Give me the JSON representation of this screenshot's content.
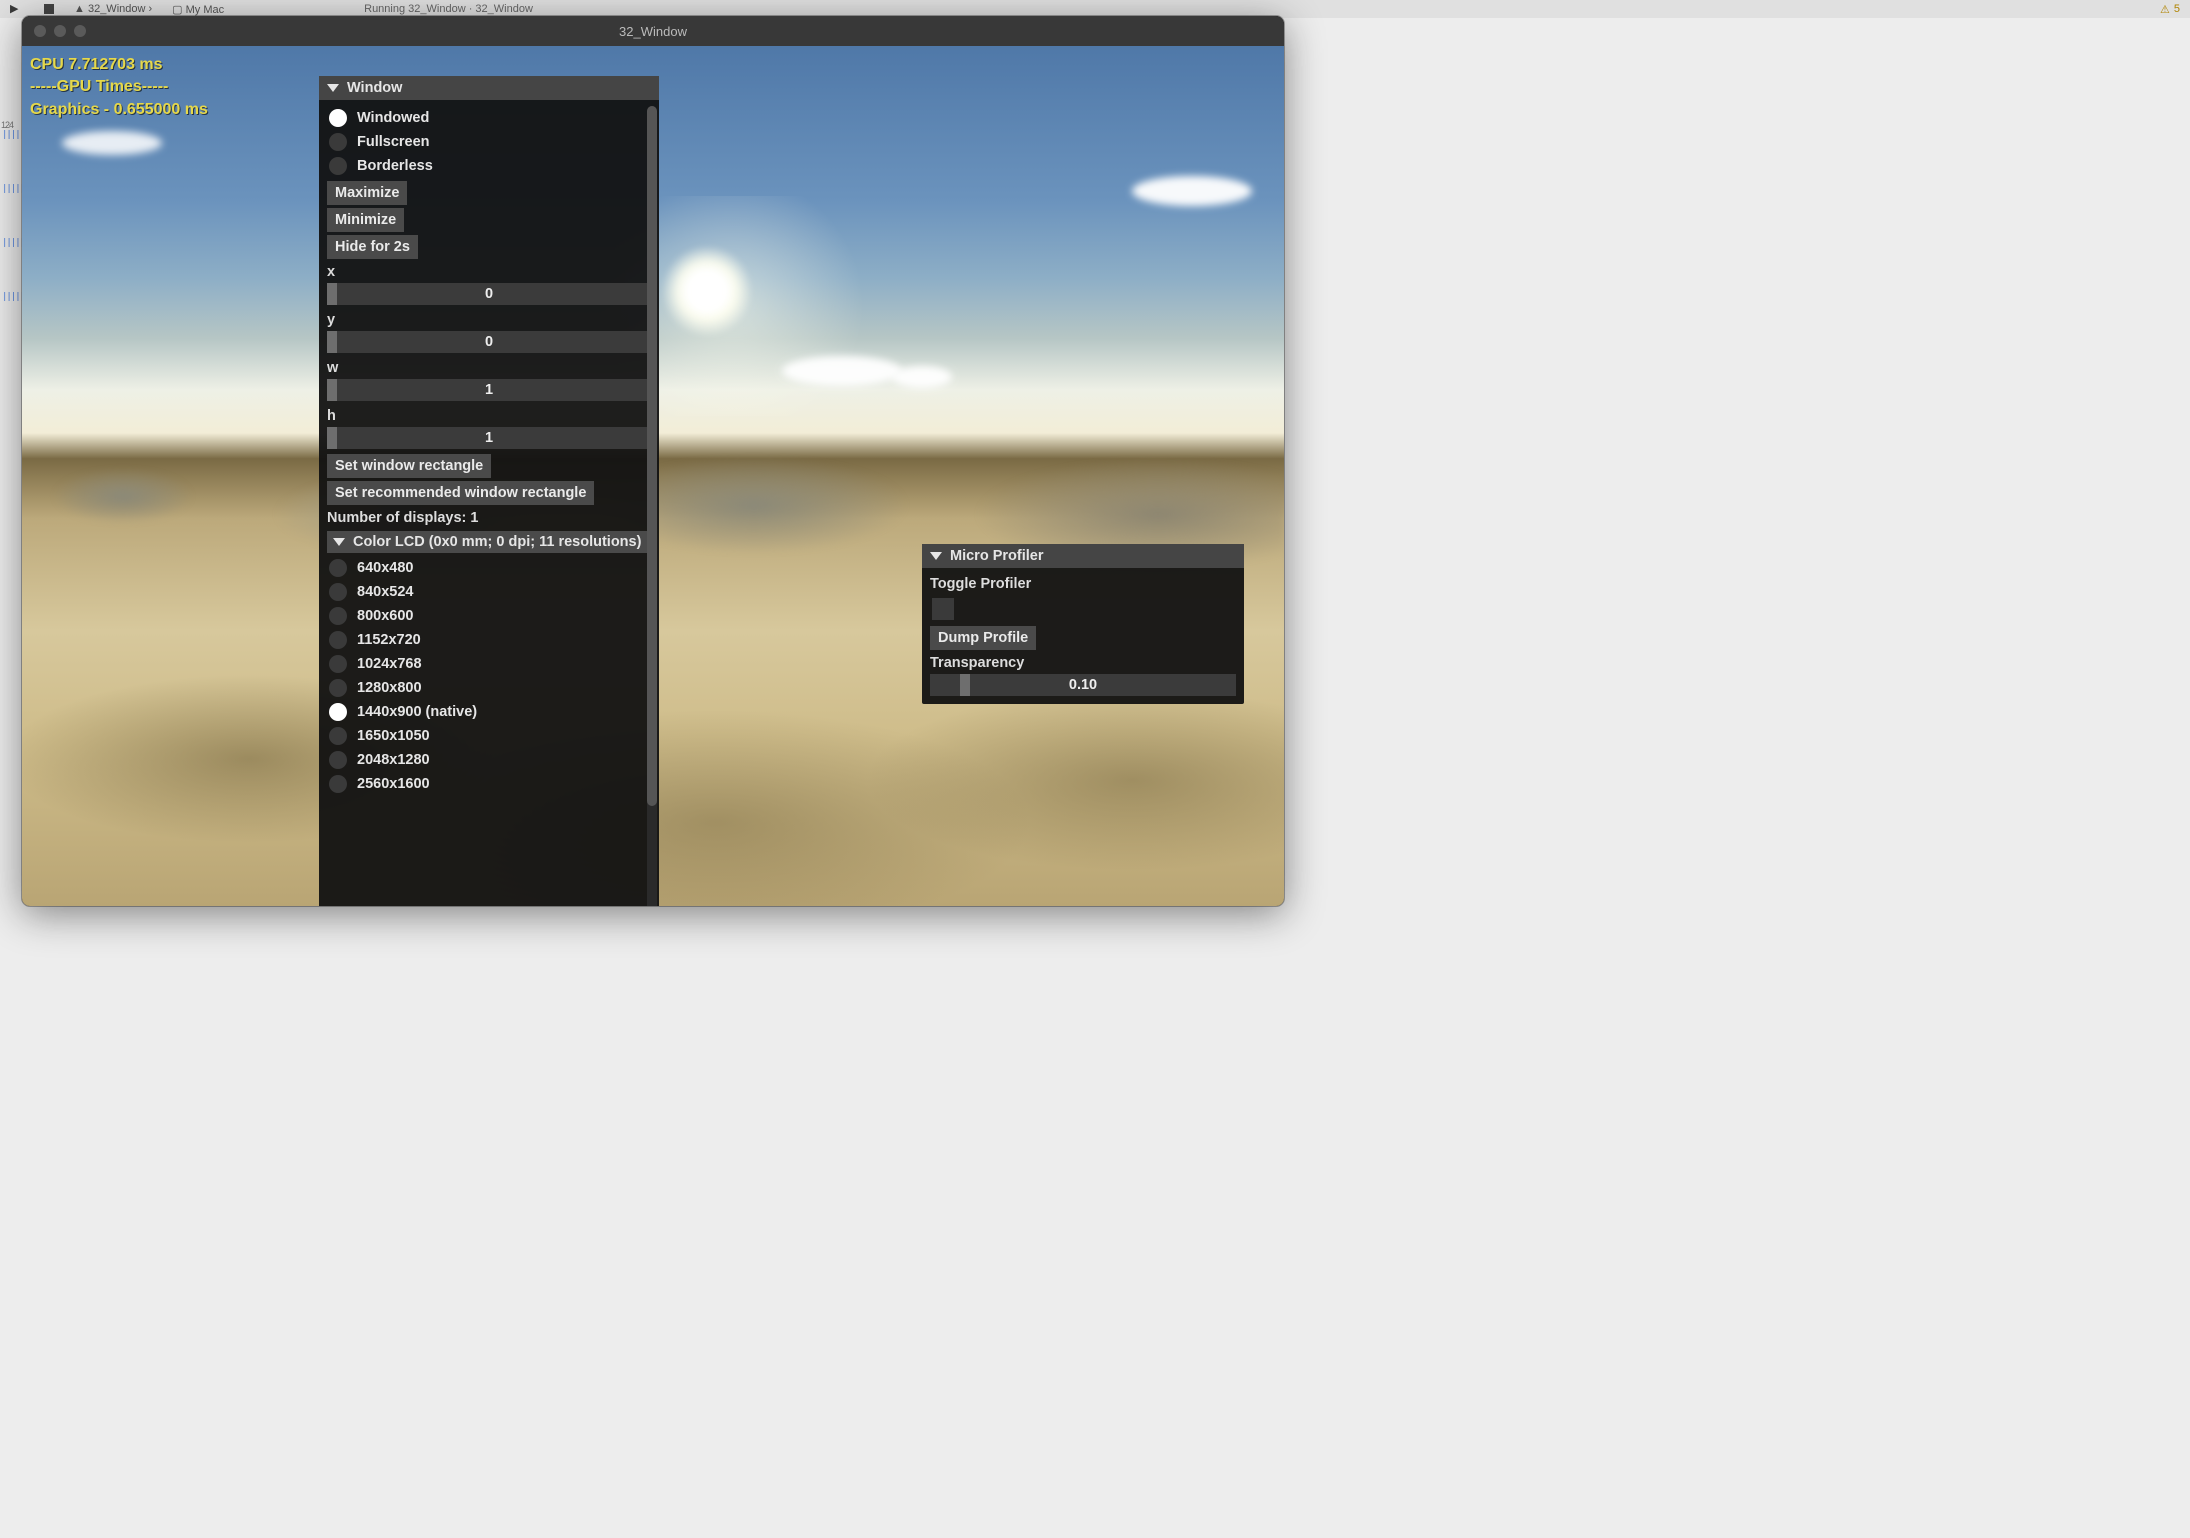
{
  "ide": {
    "breadcrumb1": "32_Window",
    "breadcrumb2": "My Mac",
    "status": "Running 32_Window · 32_Window",
    "warning_count": "5",
    "left_num": "124"
  },
  "window_title": "32_Window",
  "stats": {
    "cpu": "CPU 7.712703 ms",
    "gpu_divider": "-----GPU Times-----",
    "graphics": "Graphics - 0.655000 ms"
  },
  "panel_window": {
    "title": "Window",
    "modes": [
      {
        "label": "Windowed",
        "on": true
      },
      {
        "label": "Fullscreen",
        "on": false
      },
      {
        "label": "Borderless",
        "on": false
      }
    ],
    "buttons": {
      "maximize": "Maximize",
      "minimize": "Minimize",
      "hide": "Hide for 2s",
      "set_rect": "Set window rectangle",
      "set_reco": "Set recommended window rectangle"
    },
    "sliders": {
      "x": {
        "label": "x",
        "value": "0"
      },
      "y": {
        "label": "y",
        "value": "0"
      },
      "w": {
        "label": "w",
        "value": "1"
      },
      "h": {
        "label": "h",
        "value": "1"
      }
    },
    "displays_label": "Number of displays: 1",
    "display_header": "Color LCD (0x0 mm; 0 dpi; 11 resolutions)",
    "resolutions": [
      {
        "label": "640x480",
        "on": false
      },
      {
        "label": "840x524",
        "on": false
      },
      {
        "label": "800x600",
        "on": false
      },
      {
        "label": "1152x720",
        "on": false
      },
      {
        "label": "1024x768",
        "on": false
      },
      {
        "label": "1280x800",
        "on": false
      },
      {
        "label": "1440x900 (native)",
        "on": true
      },
      {
        "label": "1650x1050",
        "on": false
      },
      {
        "label": "2048x1280",
        "on": false
      },
      {
        "label": "2560x1600",
        "on": false
      }
    ]
  },
  "panel_profiler": {
    "title": "Micro Profiler",
    "toggle_label": "Toggle Profiler",
    "dump": "Dump Profile",
    "transparency_label": "Transparency",
    "transparency_value": "0.10"
  }
}
